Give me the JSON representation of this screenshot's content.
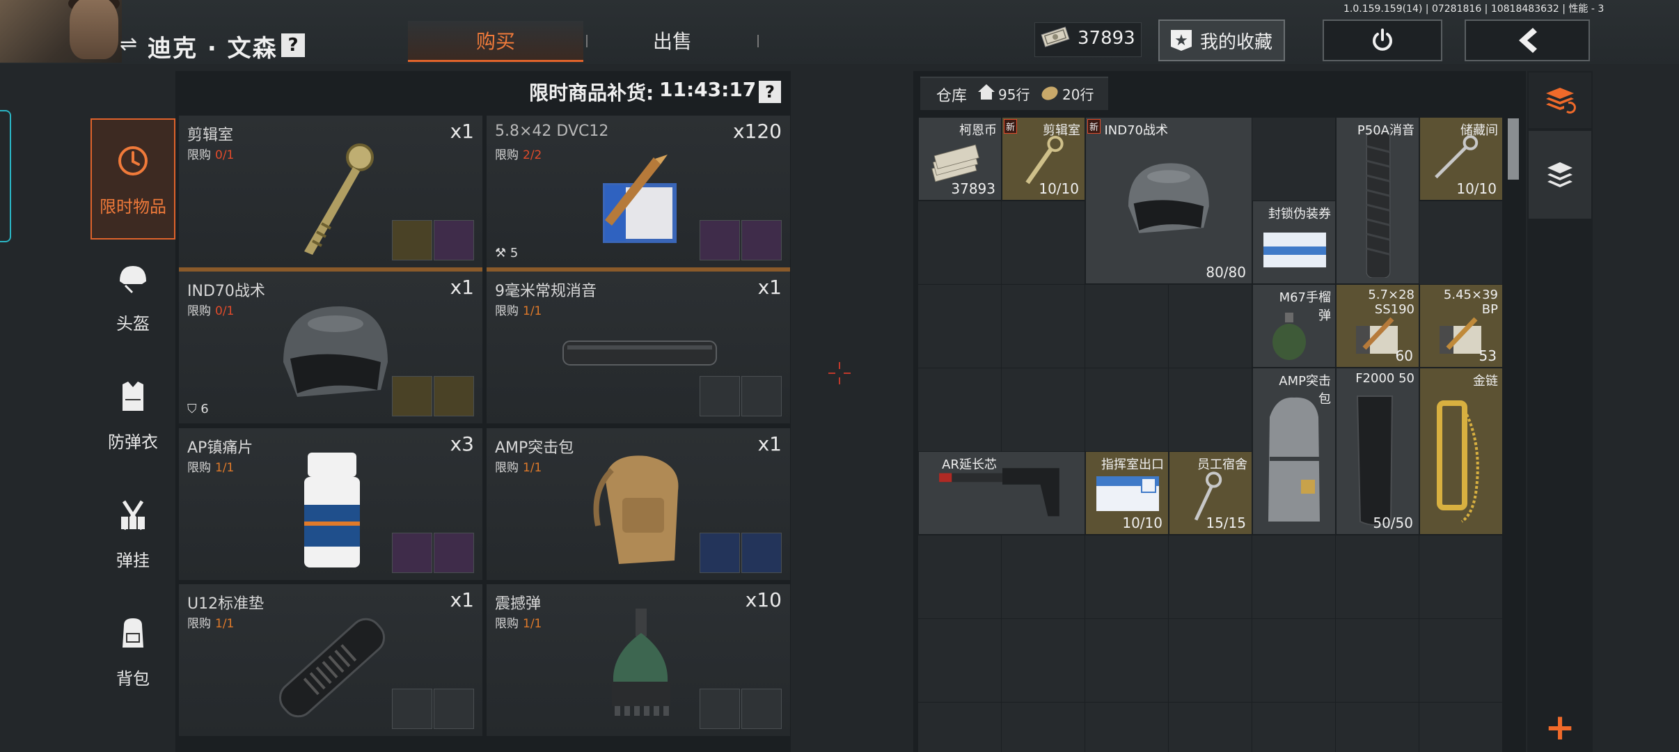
{
  "header": {
    "player_name": "迪克 · 文森",
    "help_glyph": "?",
    "tabs": [
      {
        "label": "购买",
        "active": true
      },
      {
        "label": "出售",
        "active": false
      }
    ],
    "version": "1.0.159.159(14) | 07281816 | 10818483632 | 性能 - 3",
    "currency_value": "37893",
    "favorites_label": "我的收藏"
  },
  "categories": [
    {
      "label": "限时物品",
      "icon": "clock-icon",
      "active": true
    },
    {
      "label": "头盔",
      "icon": "helmet-icon",
      "active": false
    },
    {
      "label": "防弹衣",
      "icon": "vest-icon",
      "active": false
    },
    {
      "label": "弹挂",
      "icon": "chest-rig-icon",
      "active": false
    },
    {
      "label": "背包",
      "icon": "backpack-icon",
      "active": false
    }
  ],
  "shop": {
    "restock_label": "限时商品补货:",
    "restock_time": "11:43:17",
    "limit_label": "限购",
    "items": [
      {
        "name": "剪辑室",
        "qty": "x1",
        "limit": "0/1",
        "limit_color": "#e14b2b",
        "icon": "key-icon",
        "badge": "",
        "costs": [
          "trophy-cup-icon",
          "picture-frame-icon"
        ]
      },
      {
        "name": "5.8×42 DVC12",
        "qty": "x120",
        "limit": "2/2",
        "limit_color": "#e14b2b",
        "icon": "ammo-box-icon",
        "badge": "5",
        "costs": [
          "picture-frame-icon",
          "radio-icon"
        ]
      },
      {
        "name": "IND70战术",
        "qty": "x1",
        "limit": "0/1",
        "limit_color": "#e14b2b",
        "icon": "helmet-icon",
        "badge": "6",
        "costs": [
          "rangefinder-icon",
          "gold-bar-icon"
        ]
      },
      {
        "name": "9毫米常规消音",
        "qty": "x1",
        "limit": "1/1",
        "limit_color": "#e07a2a",
        "icon": "suppressor-icon",
        "badge": "",
        "costs": [
          "horseshoe-magnet-icon",
          "book-icon"
        ]
      },
      {
        "name": "AP镇痛片",
        "qty": "x3",
        "limit": "1/1",
        "limit_color": "#e07a2a",
        "icon": "pill-bottle-icon",
        "badge": "",
        "costs": [
          "gold-case-icon",
          "syringe-icon"
        ]
      },
      {
        "name": "AMP突击包",
        "qty": "x1",
        "limit": "1/1",
        "limit_color": "#e07a2a",
        "icon": "backpack-icon",
        "badge": "",
        "costs": [
          "gold-chain-icon",
          "paper-stack-icon"
        ]
      },
      {
        "name": "U12标准垫",
        "qty": "x1",
        "limit": "1/1",
        "limit_color": "#e07a2a",
        "icon": "buttpad-icon",
        "badge": "",
        "costs": [
          "spray-can-icon",
          "horseshoe-magnet-icon"
        ]
      },
      {
        "name": "震撼弹",
        "qty": "x10",
        "limit": "1/1",
        "limit_color": "#e07a2a",
        "icon": "stun-grenade-icon",
        "badge": "",
        "costs": [
          "extinguisher-icon",
          "spray-can-icon"
        ]
      }
    ]
  },
  "stash": {
    "label": "仓库",
    "rows_home": "95行",
    "rows_bag": "20行",
    "new_tag": "新",
    "items": [
      {
        "name": "柯恩币",
        "count": "37893",
        "icon": "cash-stack-icon",
        "style": "grey",
        "new": false
      },
      {
        "name": "剪辑室",
        "count": "10/10",
        "icon": "key-icon",
        "style": "gold",
        "new": true
      },
      {
        "name": "IND70战术",
        "count": "80/80",
        "icon": "helmet-icon",
        "style": "grey",
        "new": true
      },
      {
        "name": "P50A消音",
        "count": "",
        "icon": "suppressor-icon",
        "style": "grey",
        "new": false
      },
      {
        "name": "储藏间",
        "count": "10/10",
        "icon": "key-icon",
        "style": "gold",
        "new": false
      },
      {
        "name": "封锁伪装券",
        "count": "",
        "icon": "ticket-icon",
        "style": "grey",
        "new": false
      },
      {
        "name": "M67手榴弹",
        "count": "",
        "icon": "grenade-icon",
        "style": "grey",
        "new": false
      },
      {
        "name": "5.7×28 SS190",
        "count": "60",
        "icon": "ammo-box-icon",
        "style": "gold",
        "new": false
      },
      {
        "name": "5.45×39 BP",
        "count": "53",
        "icon": "ammo-box-icon",
        "style": "gold",
        "new": false
      },
      {
        "name": "AMP突击包",
        "count": "",
        "icon": "backpack-icon",
        "style": "grey",
        "new": false
      },
      {
        "name": "F2000 50",
        "count": "50/50",
        "icon": "magazine-icon",
        "style": "grey",
        "new": false
      },
      {
        "name": "金链",
        "count": "",
        "icon": "gold-chain-icon",
        "style": "gold",
        "new": false
      },
      {
        "name": "AR延长芯",
        "count": "",
        "icon": "buffer-tube-icon",
        "style": "grey",
        "new": false
      },
      {
        "name": "指挥室出口",
        "count": "10/10",
        "icon": "keycard-icon",
        "style": "gold",
        "new": false
      },
      {
        "name": "员工宿舍",
        "count": "15/15",
        "icon": "key-icon",
        "style": "gold",
        "new": false
      }
    ]
  },
  "colors": {
    "accent": "#e0632b",
    "limit_red": "#e14b2b",
    "limit_orange": "#e07a2a",
    "gold_cell": "#5c5233"
  }
}
